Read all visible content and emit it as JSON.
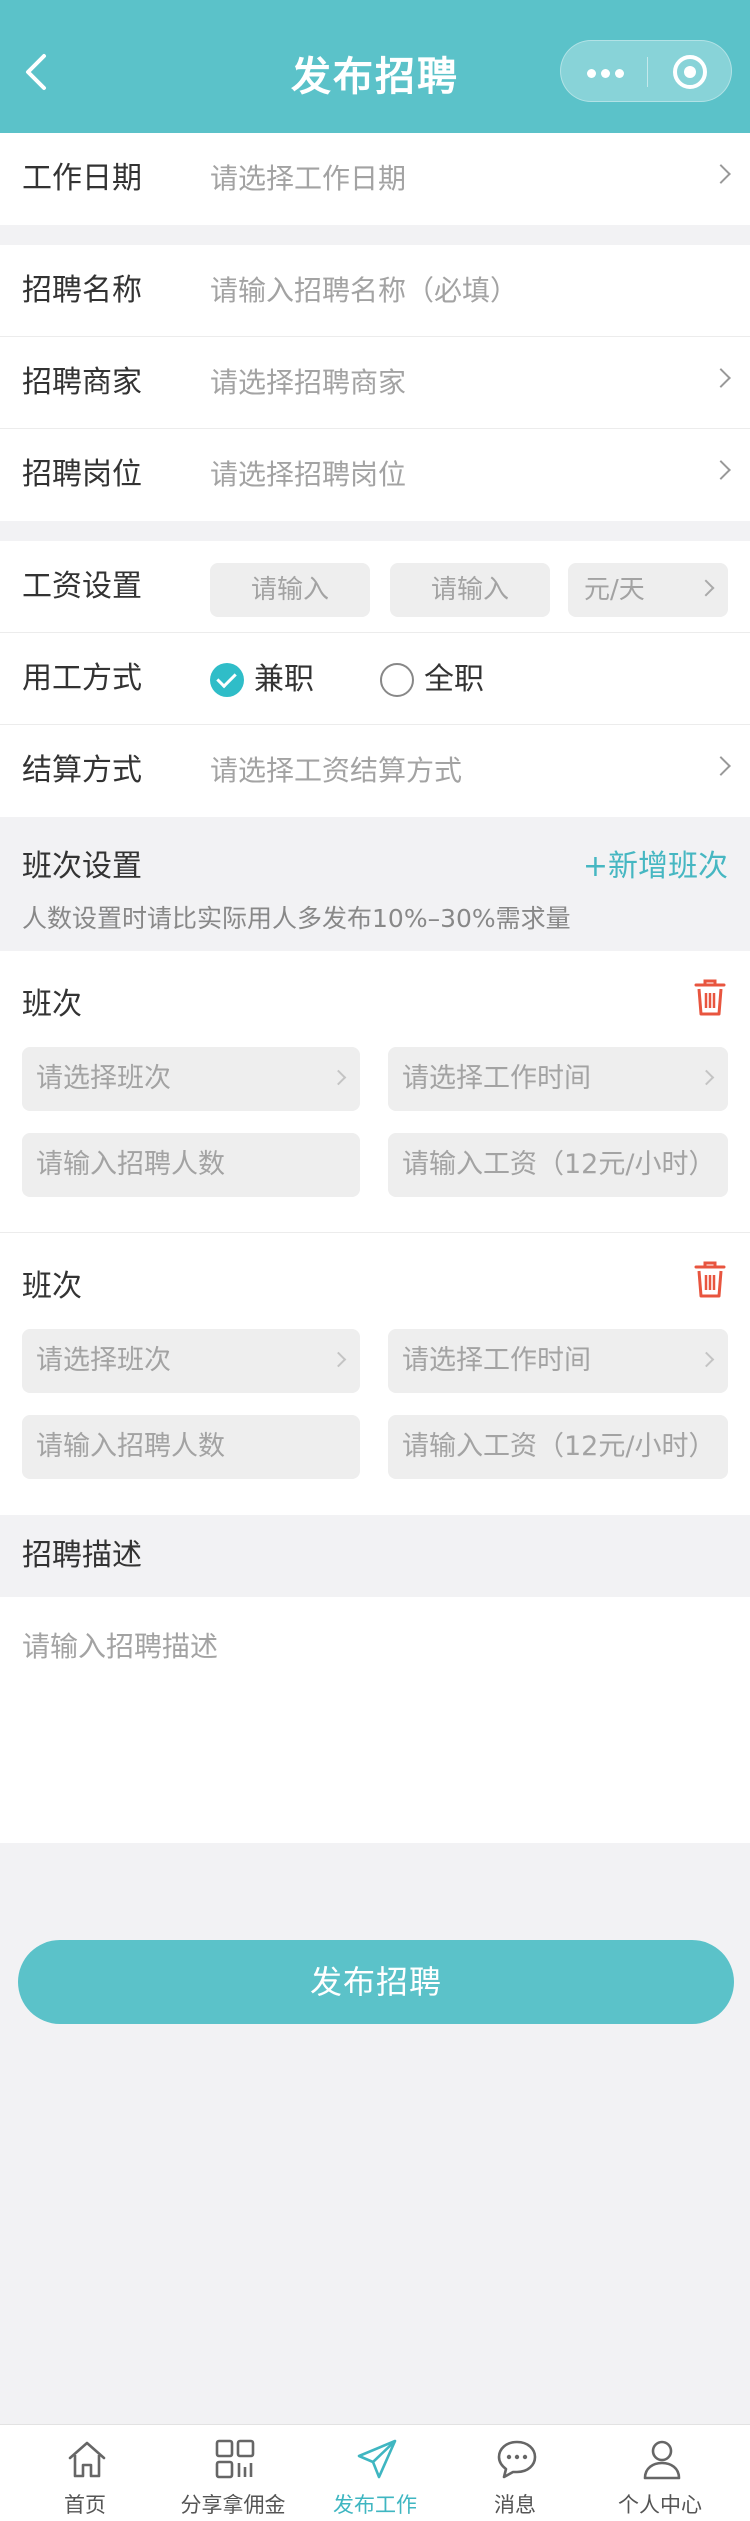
{
  "header": {
    "title": "发布招聘"
  },
  "form": {
    "work_date": {
      "label": "工作日期",
      "placeholder": "请选择工作日期"
    },
    "recruit_name": {
      "label": "招聘名称",
      "placeholder": "请输入招聘名称（必填）"
    },
    "merchant": {
      "label": "招聘商家",
      "placeholder": "请选择招聘商家"
    },
    "position": {
      "label": "招聘岗位",
      "placeholder": "请选择招聘岗位"
    },
    "salary": {
      "label": "工资设置",
      "input1": "请输入",
      "input2": "请输入",
      "unit": "元/天"
    },
    "employment": {
      "label": "用工方式",
      "options": [
        "兼职",
        "全职"
      ],
      "selected": "兼职"
    },
    "settlement": {
      "label": "结算方式",
      "placeholder": "请选择工资结算方式"
    }
  },
  "shifts": {
    "title": "班次设置",
    "add_label": "+新增班次",
    "note": "人数设置时请比实际用人多发布10%–30%需求量",
    "items": [
      {
        "title": "班次",
        "shift_placeholder": "请选择班次",
        "time_placeholder": "请选择工作时间",
        "count_placeholder": "请输入招聘人数",
        "wage_placeholder": "请输入工资（12元/小时）"
      },
      {
        "title": "班次",
        "shift_placeholder": "请选择班次",
        "time_placeholder": "请选择工作时间",
        "count_placeholder": "请输入招聘人数",
        "wage_placeholder": "请输入工资（12元/小时）"
      }
    ]
  },
  "description": {
    "title": "招聘描述",
    "placeholder": "请输入招聘描述"
  },
  "submit_label": "发布招聘",
  "tabbar": {
    "active": "发布工作",
    "items": [
      {
        "label": "首页",
        "icon": "home-icon"
      },
      {
        "label": "分享拿佣金",
        "icon": "qrcode-icon"
      },
      {
        "label": "发布工作",
        "icon": "paper-plane-icon"
      },
      {
        "label": "消息",
        "icon": "chat-bubble-icon"
      },
      {
        "label": "个人中心",
        "icon": "user-icon"
      }
    ]
  },
  "colors": {
    "primary": "#5bc2c9",
    "accent_text": "#46b7c2",
    "delete": "#e8553f",
    "background": "#f2f2f4"
  }
}
